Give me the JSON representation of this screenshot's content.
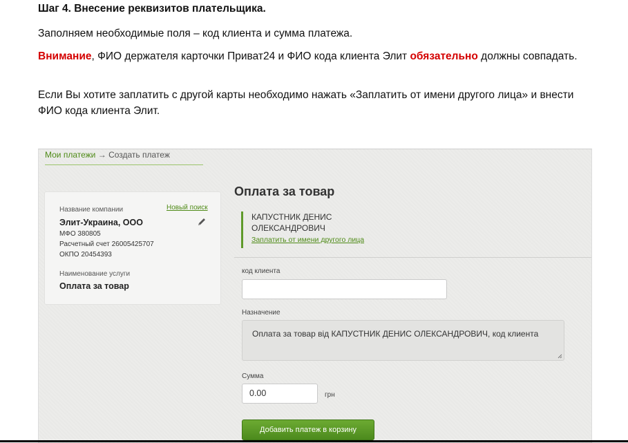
{
  "doc": {
    "heading": "Шаг 4. Внесение реквизитов плательщика.",
    "p1": "Заполняем необходимые поля – код клиента и сумма платежа.",
    "p2_warn": "Внимание",
    "p2_mid": ", ФИО держателя карточки Приват24 и ФИО кода клиента Элит ",
    "p2_must": "обязательно",
    "p2_end": " должны совпадать.",
    "p3": "Если Вы хотите заплатить с другой карты необходимо нажать «Заплатить от имени другого лица» и внести ФИО кода клиента Элит."
  },
  "breadcrumb": {
    "link": "Мои платежи",
    "arrow": "→",
    "current": "Создать платеж"
  },
  "company_card": {
    "company_label": "Название компании",
    "new_search": "Новый поиск",
    "company_name": "Элит-Украина, ООО",
    "mfo": "МФО 380805",
    "account": "Расчетный счет 26005425707",
    "okpo": "ОКПО 20454393",
    "service_label": "Наименование услуги",
    "service_name": "Оплата за товар"
  },
  "form": {
    "title": "Оплата за товар",
    "payer_name": "КАПУСТНИК ДЕНИС ОЛЕКСАНДРОВИЧ",
    "pay_other": "Заплатить от имени другого лица",
    "client_code_label": "код клиента",
    "client_code_value": "",
    "purpose_label": "Назначение",
    "purpose_value": "Оплата за товар від КАПУСТНИК ДЕНИС ОЛЕКСАНДРОВИЧ, код клиента",
    "sum_label": "Сумма",
    "sum_value": "0.00",
    "currency": "грн",
    "add_button": "Добавить платеж в корзину"
  },
  "colors": {
    "accent_green": "#4e8a16",
    "button_green": "#5c9a27",
    "warning_red": "#d40000"
  }
}
